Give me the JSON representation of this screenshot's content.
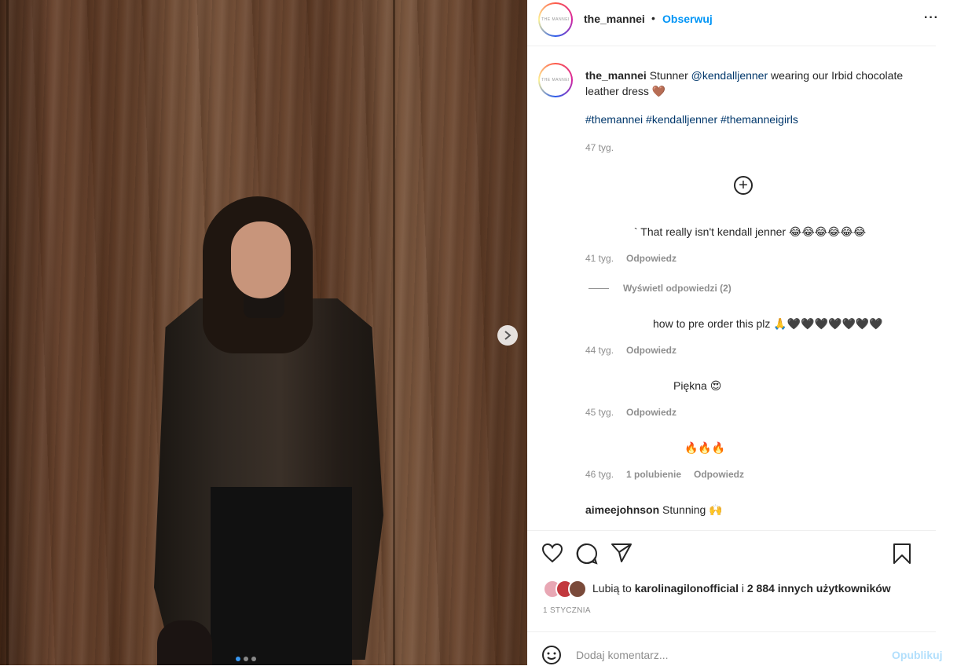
{
  "header": {
    "username": "the_mannei",
    "separator": "•",
    "follow_label": "Obserwuj",
    "more_label": "···",
    "avatar_logo_text": "THE MANNEI"
  },
  "caption": {
    "username": "the_mannei",
    "text_before": "Stunner ",
    "mention": "@kendalljenner",
    "text_after": " wearing our Irbid chocolate leather dress 🤎",
    "hashtags": "#themannei #kendalljenner #themanneigirls",
    "time": "47 tyg."
  },
  "load_more_icon": "+",
  "comments": [
    {
      "text": "` That really isn't kendall jenner 😂😂😂😂😂😂",
      "time": "41 tyg.",
      "reply_label": "Odpowiedz"
    },
    {
      "text": "how to pre order this plz 🙏🖤🖤🖤🖤🖤🖤🖤",
      "time": "44 tyg.",
      "reply_label": "Odpowiedz"
    },
    {
      "text": "Piękna 😍",
      "time": "45 tyg.",
      "reply_label": "Odpowiedz"
    },
    {
      "text": "🔥🔥🔥",
      "time": "46 tyg.",
      "likes": "1 polubienie",
      "reply_label": "Odpowiedz"
    }
  ],
  "view_replies": "Wyświetl odpowiedzi (2)",
  "last_comment": {
    "username": "aimeejohnson",
    "text": "Stunning 🙌"
  },
  "likes": {
    "prefix": "Lubią to ",
    "user": "karolinagilonofficial",
    "middle": " i ",
    "count": "2 884 innych użytkowników"
  },
  "date": "1 STYCZNIA",
  "add_comment": {
    "placeholder": "Dodaj komentarz...",
    "post_label": "Opublikuj"
  },
  "colors": {
    "follow": "#0095f6",
    "link": "#00376b",
    "muted": "#8e8e8e",
    "post_disabled": "#b2dffc"
  }
}
